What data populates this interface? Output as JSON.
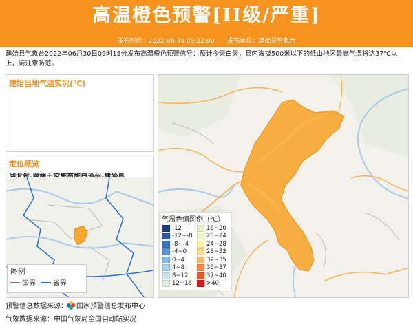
{
  "header": {
    "title": "高温橙色预警[II级/严重]",
    "publish_time_label": "发布时间：2022-06-30 09:22:00",
    "publisher_label": "发布单位：建始县气象台"
  },
  "description": "建始县气象台2022年06月30日09时18分发布高温橙色预警信号：预计今天白天，县内海拔500米以下的低山地区最高气温将达37℃以上，请注意防范。",
  "temp_panel": {
    "title": "建始当地气温实况(℃)"
  },
  "location_panel": {
    "title": "定位概览",
    "location": "湖北省-恩施土家族苗族自治州-建始县"
  },
  "small_legend": {
    "title": "图例",
    "items": [
      {
        "label": "国界",
        "color": "#c06080"
      },
      {
        "label": "省界",
        "color": "#2b6fd6"
      }
    ]
  },
  "legend": {
    "title": "气温色值图例（℃）",
    "items": [
      {
        "label": "-12",
        "color": "#1b3f8f"
      },
      {
        "label": "16~20",
        "color": "#e4f0c9"
      },
      {
        "label": "-12~-8",
        "color": "#2756a8"
      },
      {
        "label": "20~24",
        "color": "#f4f7bd"
      },
      {
        "label": "-8~-4",
        "color": "#3a75c4"
      },
      {
        "label": "24~28",
        "color": "#fbf2a7"
      },
      {
        "label": "-4~0",
        "color": "#5b95d8"
      },
      {
        "label": "28~32",
        "color": "#fadc8a"
      },
      {
        "label": "0~4",
        "color": "#84b7e6"
      },
      {
        "label": "32~35",
        "color": "#f8b968"
      },
      {
        "label": "4~8",
        "color": "#a9d1ee"
      },
      {
        "label": "35~37",
        "color": "#f38d47"
      },
      {
        "label": "8~12",
        "color": "#c9e5ef"
      },
      {
        "label": "37~40",
        "color": "#e75a2a"
      },
      {
        "label": "12~16",
        "color": "#dcefe0"
      },
      {
        "label": ">40",
        "color": "#d21d1d"
      }
    ]
  },
  "footer": {
    "warning_source": "预警信息数据来源：",
    "warning_source_name": "国家预警信息发布中心",
    "weather_source": "气象数据来源：中国气象局全国自动站实况"
  },
  "colors": {
    "accent": "#f6921e",
    "region_fill": "#f9a832"
  }
}
